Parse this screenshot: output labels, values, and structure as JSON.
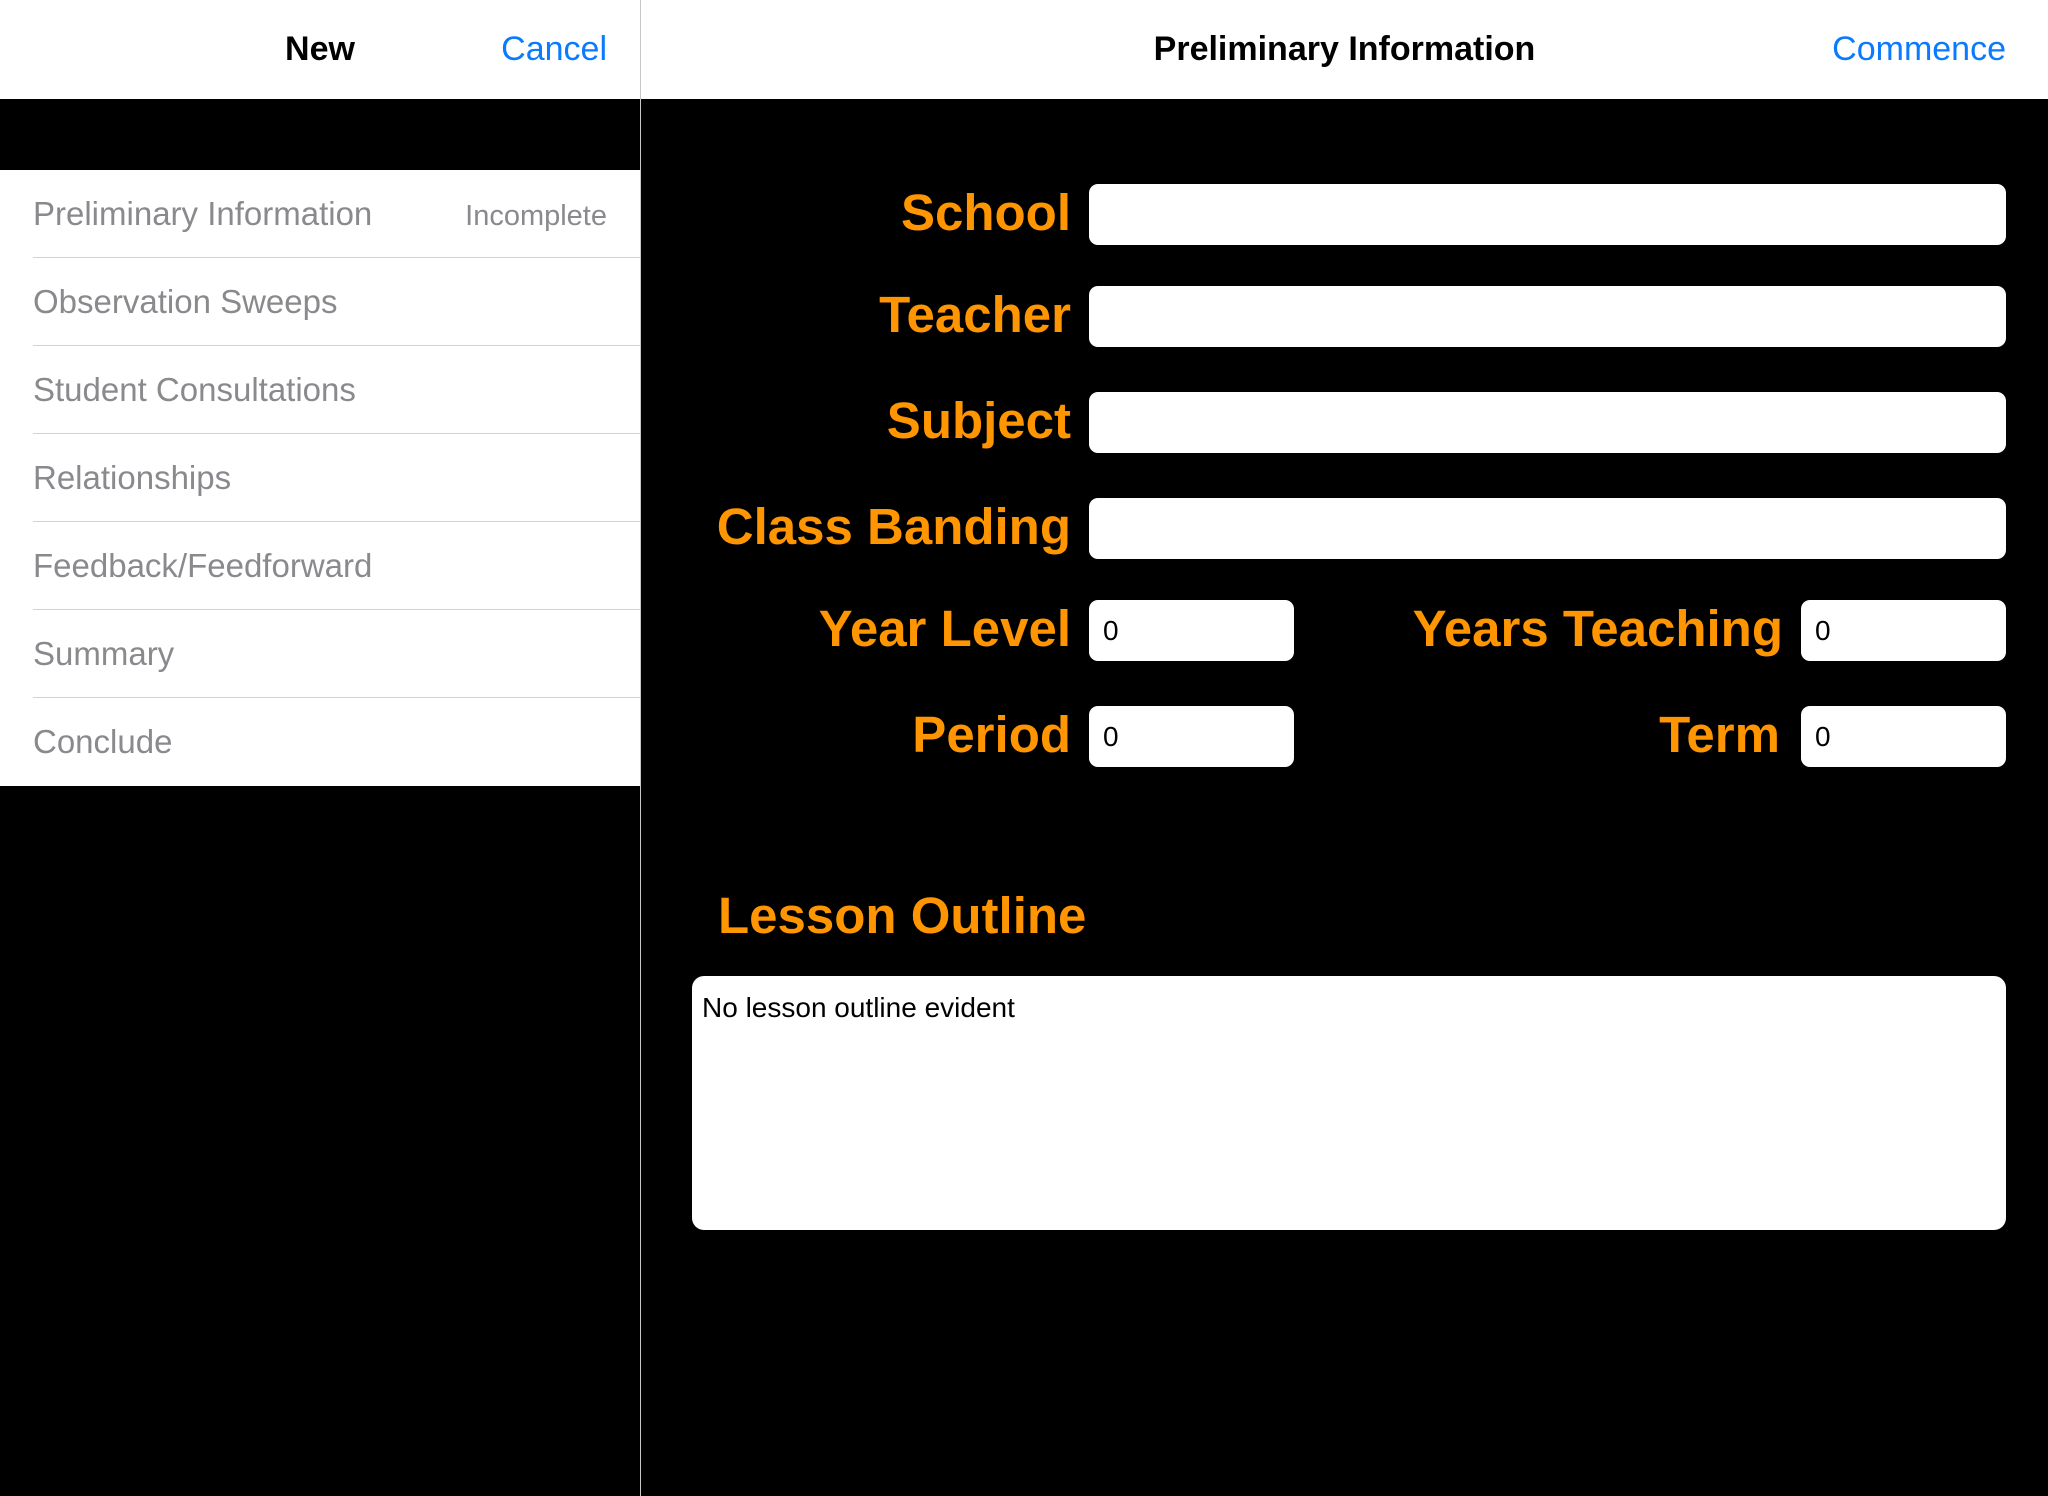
{
  "left_header": {
    "title": "New",
    "cancel_label": "Cancel"
  },
  "right_header": {
    "title": "Preliminary Information",
    "commence_label": "Commence"
  },
  "sidebar": {
    "items": [
      {
        "label": "Preliminary Information",
        "detail": "Incomplete"
      },
      {
        "label": "Observation Sweeps"
      },
      {
        "label": "Student Consultations"
      },
      {
        "label": "Relationships"
      },
      {
        "label": "Feedback/Feedforward"
      },
      {
        "label": "Summary"
      },
      {
        "label": "Conclude"
      }
    ]
  },
  "form": {
    "school": {
      "label": "School",
      "value": ""
    },
    "teacher": {
      "label": "Teacher",
      "value": ""
    },
    "subject": {
      "label": "Subject",
      "value": ""
    },
    "class_banding": {
      "label": "Class Banding",
      "value": ""
    },
    "year_level": {
      "label": "Year Level",
      "value": "0"
    },
    "years_teaching": {
      "label": "Years Teaching",
      "value": "0"
    },
    "period": {
      "label": "Period",
      "value": "0"
    },
    "term": {
      "label": "Term",
      "value": "0"
    },
    "lesson_outline": {
      "label": "Lesson Outline",
      "value": "No lesson outline evident"
    }
  },
  "colors": {
    "accent": "#0A7AFF",
    "label": "#FF9500",
    "background": "#000000"
  }
}
